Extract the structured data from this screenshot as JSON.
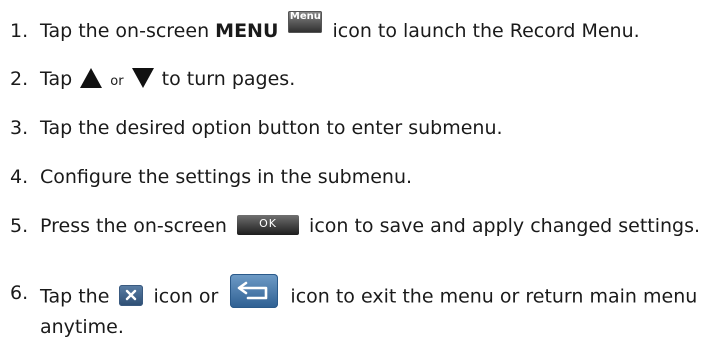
{
  "steps": [
    {
      "number": "1.",
      "text_before": "Tap the on-screen ",
      "bold": "MENU",
      "text_after": " icon to launch the Record Menu.",
      "icon": {
        "name": "menu-icon",
        "label": "Menu"
      }
    },
    {
      "number": "2.",
      "text_before": "Tap ",
      "or": "or",
      "text_after": " to turn pages.",
      "icons": [
        "up-arrow-icon",
        "down-arrow-icon"
      ]
    },
    {
      "number": "3.",
      "text": "Tap the desired option button to enter submenu."
    },
    {
      "number": "4.",
      "text": "Configure the settings in the submenu."
    },
    {
      "number": "5.",
      "text_before": "Press the on-screen ",
      "text_after": " icon to save and apply changed settings.",
      "icon": {
        "name": "ok-icon",
        "label": "OK"
      }
    },
    {
      "number": "6.",
      "text_before": "Tap the ",
      "text_middle": " icon or ",
      "text_after": " icon to exit the menu or return main menu anytime.",
      "icons": [
        "close-icon",
        "return-icon"
      ]
    }
  ],
  "colors": {
    "text": "#1a1a1a",
    "menu_icon": "#2c2c2c",
    "ok_icon": "#1d1d1d",
    "close_icon": "#2d4d72",
    "return_icon": "#2e5f92"
  }
}
